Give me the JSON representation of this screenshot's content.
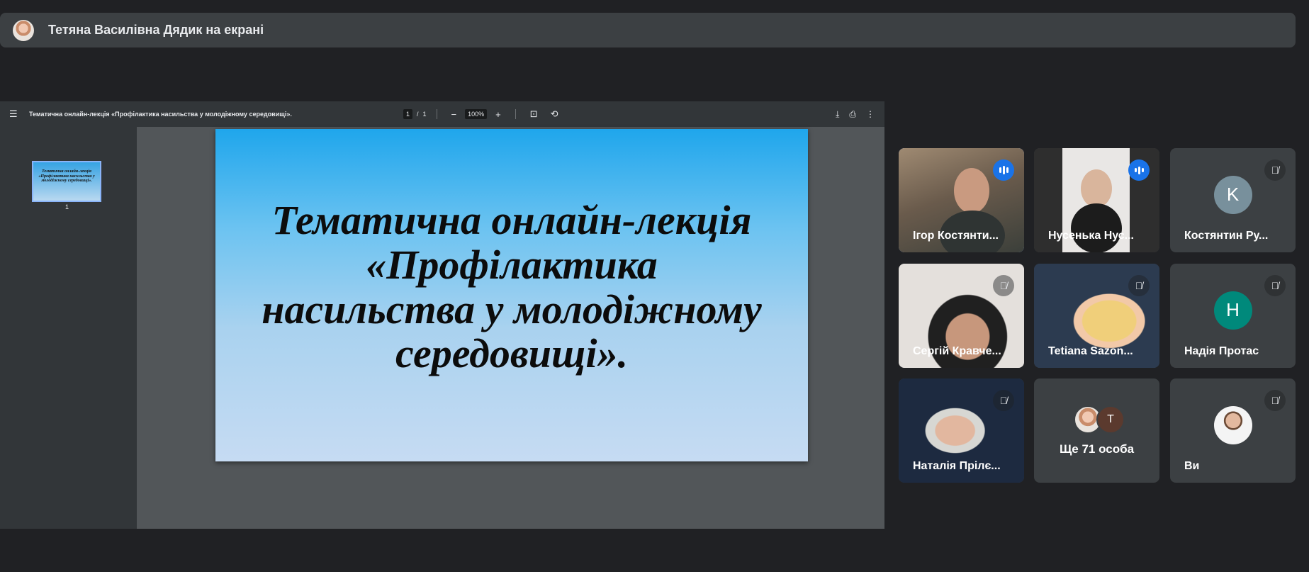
{
  "banner": {
    "presenter_text": "Тетяна Василівна Дядик на екрані"
  },
  "pdf": {
    "title": "Тематична онлайн-лекція «Профілактика насильства у молодіжному середовищі».",
    "page_current": "1",
    "page_separator": "/",
    "page_total": "1",
    "zoom": "100%",
    "thumbnail_text": "Тематична онлайн-лекція «Профілактика насильства у молодіжному середовищі».",
    "thumbnail_number": "1",
    "slide_lines": [
      "Тематична онлайн-лекція",
      "«Профілактика",
      "насильства у молодіжному",
      "середовищі»."
    ]
  },
  "participants": [
    {
      "name": "Ігор Костянти..."
    },
    {
      "name": "Нусенька Нус..."
    },
    {
      "name": "Костянтин Ру...",
      "initial": "K",
      "color": "#78909c"
    },
    {
      "name": "Сергій Кравче..."
    },
    {
      "name": "Tetiana Sazon..."
    },
    {
      "name": "Надія Протас",
      "initial": "H",
      "color": "#00897b"
    },
    {
      "name": "Наталія Прілє..."
    },
    {
      "more": "Ще 71 особа",
      "initial": "T"
    },
    {
      "name": "Ви"
    }
  ]
}
